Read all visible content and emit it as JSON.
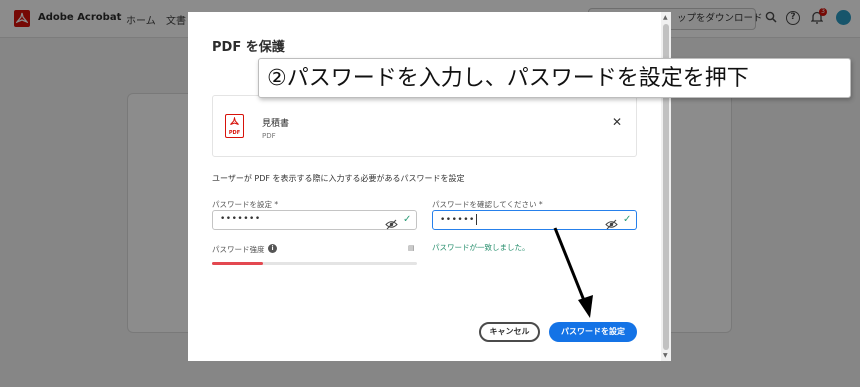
{
  "app": {
    "name": "Adobe Acrobat",
    "nav": {
      "home": "ホーム",
      "documents": "文書"
    },
    "desktop_button": "ップをダウンロード",
    "notification_count": "3"
  },
  "modal": {
    "title": "PDF を保護",
    "file": {
      "name": "見積書",
      "type": "PDF",
      "icon_label": "PDF"
    },
    "description": "ユーザーが PDF を表示する際に入力する必要があるパスワードを設定",
    "set_password": {
      "label": "パスワードを設定 *",
      "value": "•••••••"
    },
    "confirm_password": {
      "label": "パスワードを確認してください *",
      "value": "••••••"
    },
    "strength": {
      "label": "パスワード強度",
      "level": 0.25,
      "color": "#e34850"
    },
    "match_message": "パスワードが一致しました。",
    "buttons": {
      "cancel": "キャンセル",
      "set": "パスワードを設定"
    }
  },
  "annotation": {
    "callout": "②パスワードを入力し、パスワードを設定を押下"
  },
  "colors": {
    "accent": "#1473e6",
    "brand": "#d7120a",
    "success": "#268e6c"
  }
}
